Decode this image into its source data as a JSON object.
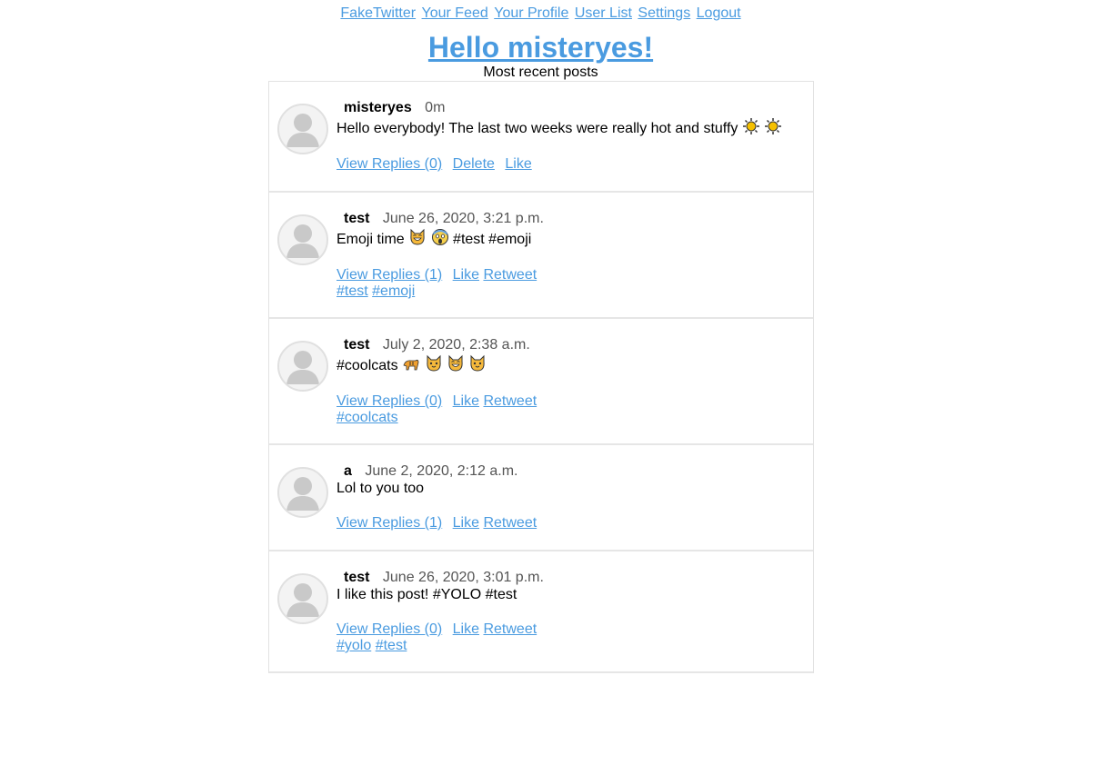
{
  "nav": {
    "items": [
      "FakeTwitter",
      "Your Feed",
      "Your Profile",
      "User List",
      "Settings",
      "Logout"
    ]
  },
  "header": {
    "greeting": "Hello misteryes!",
    "subtitle": "Most recent posts"
  },
  "posts": [
    {
      "username": "misteryes",
      "time": "0m",
      "text": "Hello everybody! The last two weeks were really hot and stuffy",
      "emojis": [
        "sun-emoji",
        "sun-emoji"
      ],
      "replies_label": "View Replies (0)",
      "delete_label": "Delete",
      "like_label": "Like",
      "retweet_label": "",
      "tags": []
    },
    {
      "username": "test",
      "time": "June 26, 2020, 3:21 p.m.",
      "text": "Emoji time",
      "text_after": "#test #emoji",
      "emojis": [
        "grinning-cat-emoji",
        "screaming-face-emoji"
      ],
      "replies_label": "View Replies (1)",
      "like_label": "Like",
      "retweet_label": "Retweet",
      "tags": [
        "#test",
        "#emoji"
      ]
    },
    {
      "username": "test",
      "time": "July 2, 2020, 2:38 a.m.",
      "text": "#coolcats",
      "emojis": [
        "tiger-emoji",
        "cat-face-emoji",
        "grinning-cat-emoji",
        "cat-face-emoji"
      ],
      "replies_label": "View Replies (0)",
      "like_label": "Like",
      "retweet_label": "Retweet",
      "tags": [
        "#coolcats"
      ]
    },
    {
      "username": "a",
      "time": "June 2, 2020, 2:12 a.m.",
      "text": "Lol to you too",
      "emojis": [],
      "replies_label": "View Replies (1)",
      "like_label": "Like",
      "retweet_label": "Retweet",
      "tags": []
    },
    {
      "username": "test",
      "time": "June 26, 2020, 3:01 p.m.",
      "text": "I like this post! #YOLO #test",
      "emojis": [],
      "replies_label": "View Replies (0)",
      "like_label": "Like",
      "retweet_label": "Retweet",
      "tags": [
        "#yolo",
        "#test"
      ]
    }
  ]
}
